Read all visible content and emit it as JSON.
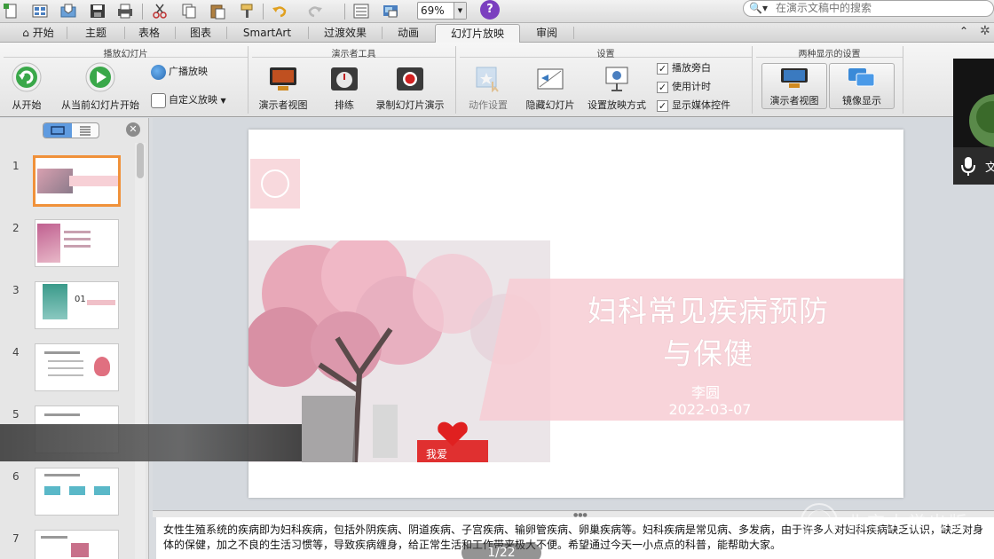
{
  "toolbar": {
    "zoom": "69%",
    "search_placeholder": "在演示文稿中的搜索",
    "icons": [
      "new-document-icon",
      "template-gallery-icon",
      "open-icon",
      "save-icon",
      "print-icon",
      "cut-icon",
      "copy-icon",
      "paste-icon",
      "format-painter-icon",
      "undo-icon",
      "redo-icon",
      "slide-layout-icon",
      "media-browser-icon",
      "help-icon"
    ]
  },
  "ribbon_tabs": [
    {
      "label": "开始",
      "active": false
    },
    {
      "label": "主题",
      "active": false
    },
    {
      "label": "表格",
      "active": false
    },
    {
      "label": "图表",
      "active": false
    },
    {
      "label": "SmartArt",
      "active": false
    },
    {
      "label": "过渡效果",
      "active": false
    },
    {
      "label": "动画",
      "active": false
    },
    {
      "label": "幻灯片放映",
      "active": true
    },
    {
      "label": "审阅",
      "active": false
    }
  ],
  "ribbon": {
    "play_group": {
      "title": "播放幻灯片",
      "from_start": "从开始",
      "from_current": "从当前幻灯片开始",
      "broadcast": "广播放映",
      "custom_show": "自定义放映"
    },
    "presenter_group": {
      "title": "演示者工具",
      "presenter_view": "演示者视图",
      "rehearse": "排练",
      "record": "录制幻灯片演示"
    },
    "setup_group": {
      "title": "设置",
      "action_settings": "动作设置",
      "hide_slide": "隐藏幻灯片",
      "setup_show": "设置放映方式",
      "play_narration": "播放旁白",
      "use_timings": "使用计时",
      "show_media_controls": "显示媒体控件",
      "check_mark": "✓"
    },
    "display_group": {
      "title": "两种显示的设置",
      "presenter_view": "演示者视图",
      "mirror_display": "镜像显示"
    }
  },
  "slides": [
    {
      "number": "1"
    },
    {
      "number": "2"
    },
    {
      "number": "3",
      "thumb_text": "01"
    },
    {
      "number": "4"
    },
    {
      "number": "5"
    },
    {
      "number": "6"
    },
    {
      "number": "7"
    }
  ],
  "current_slide": {
    "title_line1": "妇科常见疾病预防",
    "title_line2": "与保健",
    "author": "李圆",
    "date": "2022-03-07",
    "banner_text": "我爱"
  },
  "notes": "女性生殖系统的疾病即为妇科疾病，包括外阴疾病、阴道疾病、子宫疾病、输卵管疾病、卵巢疾病等。妇科疾病是常见病、多发病，由于许多人对妇科疾病缺乏认识，缺乏对身体的保健，加之不良的生活习惯等，导致疾病缠身，给正常生活和工作带来极大不便。希望通过今天一小点点的科普，能帮助大家。",
  "slide_counter": "1/22",
  "video_participant": {
    "name_initial": "文"
  },
  "watermark": "北京大学出版"
}
